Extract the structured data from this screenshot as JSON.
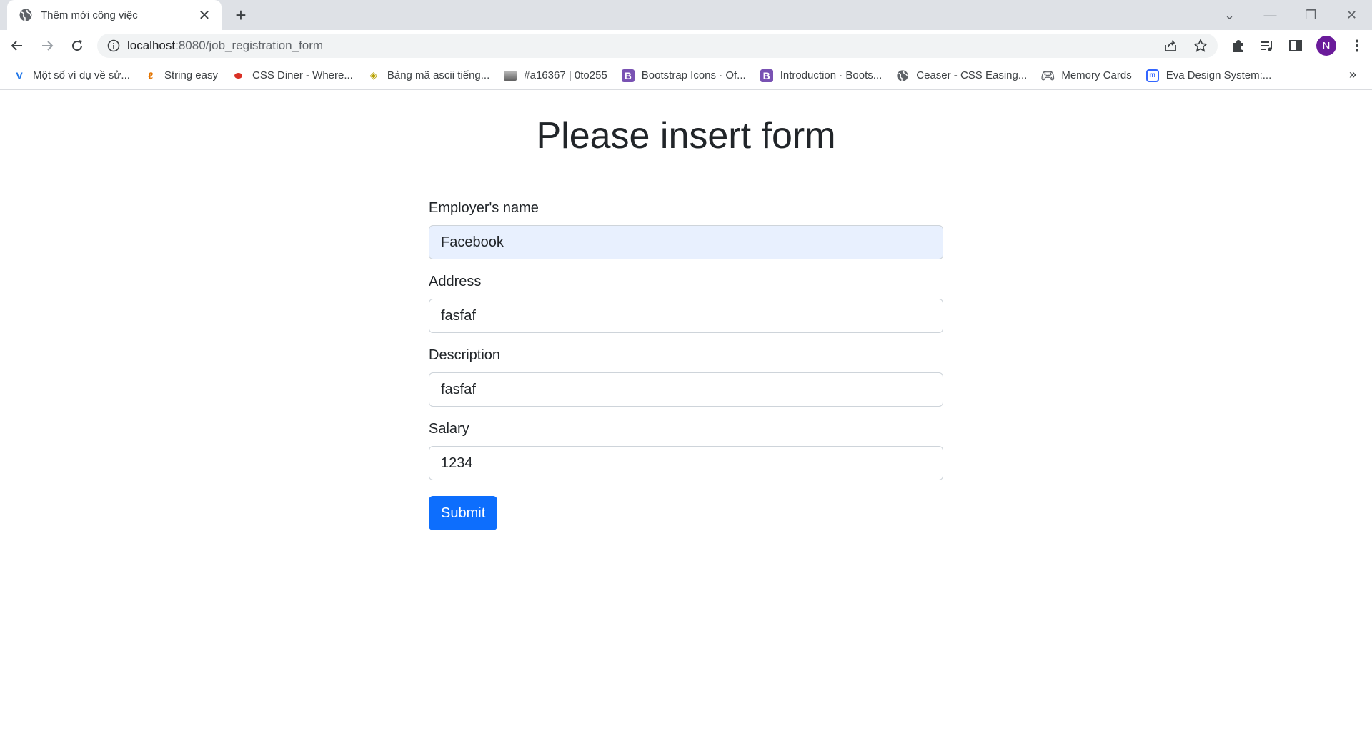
{
  "browser": {
    "tab": {
      "title": "Thêm mới công việc",
      "favicon": "globe-icon"
    },
    "url_host": "localhost",
    "url_rest": ":8080/job_registration_form",
    "profile_initial": "N",
    "bookmarks": [
      {
        "label": "Một số ví dụ về sử...",
        "icon": "v-logo-icon",
        "color": "#1a73e8"
      },
      {
        "label": "String easy",
        "icon": "string-easy-icon",
        "color": "#e37400"
      },
      {
        "label": "CSS Diner - Where...",
        "icon": "red-dot-icon",
        "color": "#d93025"
      },
      {
        "label": "Bảng mã ascii tiếng...",
        "icon": "diamond-icon",
        "color": "#b7a100"
      },
      {
        "label": "#a16367 | 0to255",
        "icon": "gradient-icon",
        "color": "#9aa0a6"
      },
      {
        "label": "Bootstrap Icons · Of...",
        "icon": "bootstrap-icon",
        "color": "#7952b3"
      },
      {
        "label": "Introduction · Boots...",
        "icon": "bootstrap-icon",
        "color": "#7952b3"
      },
      {
        "label": "Ceaser - CSS Easing...",
        "icon": "globe-icon",
        "color": "#5f6368"
      },
      {
        "label": "Memory Cards",
        "icon": "gamepad-icon",
        "color": "#5f6368"
      },
      {
        "label": "Eva Design System:...",
        "icon": "eva-icon",
        "color": "#3366ff"
      }
    ]
  },
  "page": {
    "title": "Please insert form",
    "fields": [
      {
        "label": "Employer's name",
        "value": "Facebook"
      },
      {
        "label": "Address",
        "value": "fasfaf"
      },
      {
        "label": "Description",
        "value": "fasfaf"
      },
      {
        "label": "Salary",
        "value": "1234"
      }
    ],
    "submit_label": "Submit",
    "primary_color": "#0d6efd"
  }
}
